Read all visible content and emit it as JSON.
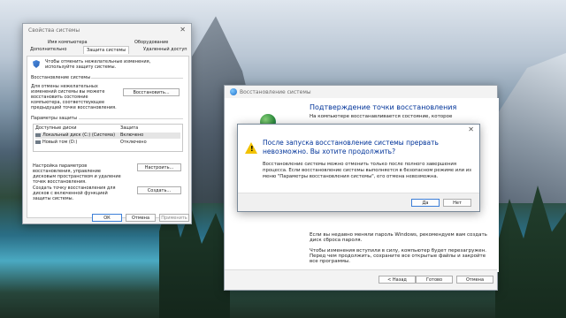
{
  "system_properties": {
    "title": "Свойства системы",
    "tabs": [
      "Имя компьютера",
      "Оборудование",
      "Дополнительно",
      "Защита системы",
      "Удаленный доступ"
    ],
    "intro": "Чтобы отменить нежелательные изменения, используйте защиту системы.",
    "restore_group": "Восстановление системы",
    "restore_desc": "Для отмены нежелательных изменений системы вы можете восстановить состояние компьютера, соответствующее предыдущей точке восстановления.",
    "restore_button": "Восстановить...",
    "protection_group": "Параметры защиты",
    "col_drives": "Доступные диски",
    "col_protection": "Защита",
    "drives": [
      {
        "name": "Локальный диск (C:) (Система)",
        "status": "Включено"
      },
      {
        "name": "Новый том (D:)",
        "status": "Отключено"
      }
    ],
    "configure_desc": "Настройка параметров восстановления, управление дисковым пространством и удаление точек восстановления.",
    "configure_button": "Настроить...",
    "create_desc": "Создать точку восстановления для дисков с включенной функцией защиты системы.",
    "create_button": "Создать...",
    "ok": "ОК",
    "cancel": "Отмена",
    "apply": "Применить"
  },
  "restore_wizard": {
    "title": "Восстановление системы",
    "heading": "Подтверждение точки восстановления",
    "text1": "На компьютере восстанавливается состояние, которое",
    "text2": "Если вы недавно меняли пароль Windows, рекомендуем вам создать диск сброса пароля.",
    "text3": "Чтобы изменения вступили в силу, компьютер будет перезагружен. Перед чем продолжить, сохраните все открытые файлы и закройте все программы.",
    "back": "< Назад",
    "finish": "Готово",
    "cancel": "Отмена"
  },
  "confirm_dialog": {
    "title": "Восстановление системы",
    "question": "После запуска восстановление системы прервать невозможно. Вы хотите продолжить?",
    "details": "Восстановление системы можно отменить только после полного завершения процесса. Если восстановление системы выполняется в безопасном режиме или из меню \"Параметры восстановления системы\", его отмена невозможна.",
    "yes": "Да",
    "no": "Нет"
  }
}
